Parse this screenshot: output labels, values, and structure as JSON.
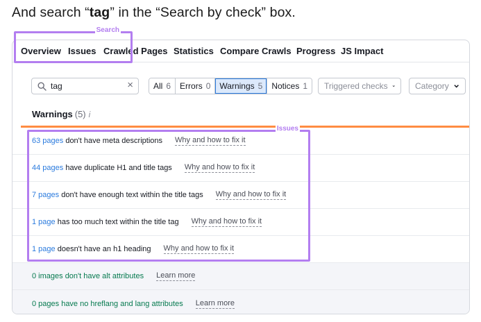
{
  "caption": {
    "prefix": "And search “",
    "keyword": "tag",
    "suffix": "” in the “Search by check” box."
  },
  "tabs": [
    {
      "label": "Overview",
      "active": false
    },
    {
      "label": "Issues",
      "active": true
    },
    {
      "label": "Crawled Pages",
      "active": false
    },
    {
      "label": "Statistics",
      "active": false
    },
    {
      "label": "Compare Crawls",
      "active": false
    },
    {
      "label": "Progress",
      "active": false
    },
    {
      "label": "JS Impact",
      "active": false
    }
  ],
  "search": {
    "value": "tag",
    "annotation_label": "Search",
    "icon": "search-icon",
    "clear_icon": "close-icon"
  },
  "filters": [
    {
      "label": "All",
      "count": "6",
      "active": false
    },
    {
      "label": "Errors",
      "count": "0",
      "active": false
    },
    {
      "label": "Warnings",
      "count": "5",
      "active": true
    },
    {
      "label": "Notices",
      "count": "1",
      "active": false
    }
  ],
  "dropdowns": {
    "triggered": "Triggered checks",
    "category": "Category"
  },
  "warnings_header": {
    "title": "Warnings",
    "count": "(5)",
    "info_icon": "i"
  },
  "issues_annotation_label": "Issues",
  "issues": [
    {
      "link": "63 pages",
      "text": " don't have meta descriptions",
      "fix": "Why and how to fix it"
    },
    {
      "link": "44 pages",
      "text": " have duplicate H1 and title tags",
      "fix": "Why and how to fix it"
    },
    {
      "link": "7 pages",
      "text": " don't have enough text within the title tags",
      "fix": "Why and how to fix it"
    },
    {
      "link": "1 page",
      "text": " has too much text within the title tag",
      "fix": "Why and how to fix it"
    },
    {
      "link": "1 page",
      "text": " doesn't have an h1 heading",
      "fix": "Why and how to fix it"
    }
  ],
  "passed": [
    {
      "text": "0 images don't have alt attributes",
      "more": "Learn more"
    },
    {
      "text": "0 pages have no hreflang and lang attributes",
      "more": "Learn more"
    }
  ],
  "colors": {
    "accent": "#2b7bde",
    "annotation": "#b37ef0",
    "warning_bar": "#ff8c42",
    "passed_text": "#067a4f"
  }
}
